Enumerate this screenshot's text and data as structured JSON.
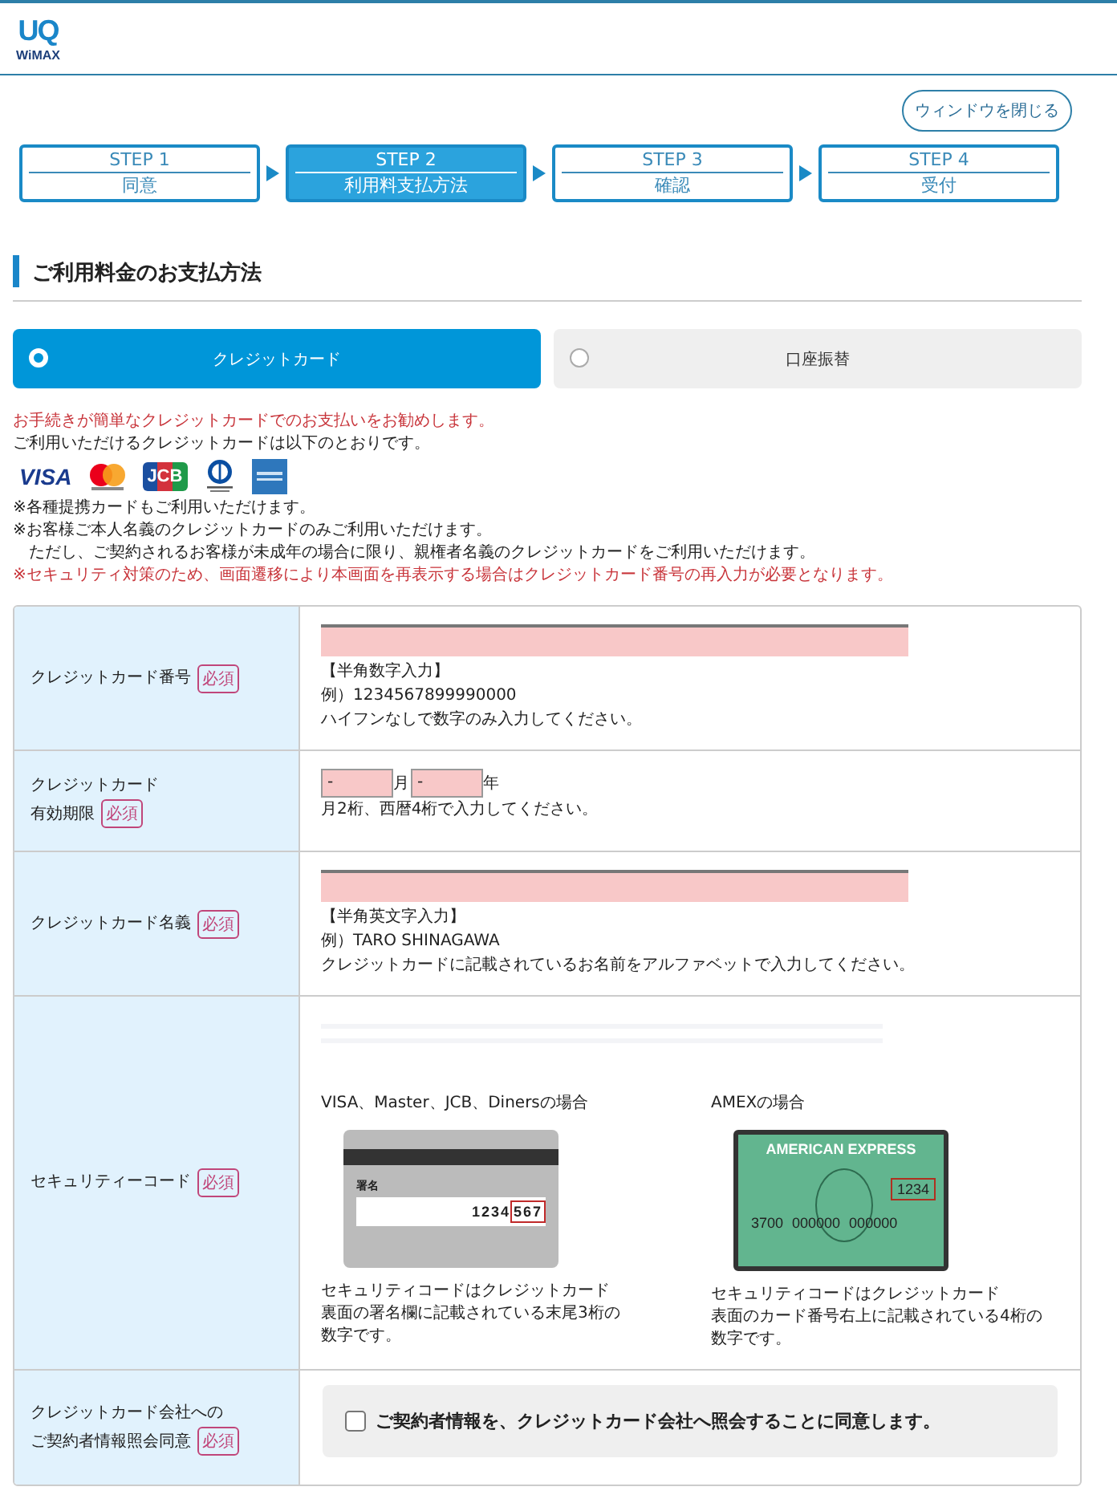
{
  "header": {
    "logo_top": "UQ",
    "logo_bottom": "WiMAX"
  },
  "close_button": "ウィンドウを閉じる",
  "steps": [
    {
      "step": "STEP 1",
      "label": "同意",
      "selected": false
    },
    {
      "step": "STEP 2",
      "label": "利用料支払方法",
      "selected": true
    },
    {
      "step": "STEP 3",
      "label": "確認",
      "selected": false
    },
    {
      "step": "STEP 4",
      "label": "受付",
      "selected": false
    }
  ],
  "section_title": "ご利用料金のお支払方法",
  "payment_tabs": [
    {
      "label": "クレジットカード",
      "selected": true
    },
    {
      "label": "口座振替",
      "selected": false
    }
  ],
  "notes_before": [
    {
      "kind": "alert",
      "text": "お手続きが簡単なクレジットカードでのお支払いをお勧めします。"
    },
    {
      "kind": "plain",
      "text": "ご利用いただけるクレジットカードは以下のとおりです。"
    }
  ],
  "card_brands": [
    {
      "kind": "visa",
      "label": "VISA"
    },
    {
      "kind": "mastercard"
    },
    {
      "kind": "jcb",
      "label": "JCB"
    },
    {
      "kind": "diners"
    },
    {
      "kind": "amex"
    }
  ],
  "notes_after": [
    {
      "kind": "plain",
      "text": "※各種提携カードもご利用いただけます。"
    },
    {
      "kind": "plain",
      "text": "※お客様ご本人名義のクレジットカードのみご利用いただけます。"
    },
    {
      "kind": "indent",
      "text": "ただし、ご契約されるお客様が未成年の場合に限り、親権者名義のクレジットカードをご利用いただけます。"
    },
    {
      "kind": "alert",
      "text": "※セキュリティ対策のため、画面遷移により本画面を再表示する場合はクレジットカード番号の再入力が必要となります。"
    }
  ],
  "form_rows": [
    {
      "kind": "text_input",
      "label": [
        "クレジットカード番号"
      ],
      "required": "必須",
      "hint": [
        "【半角数字入力】",
        "例）1234567899990000",
        "ハイフンなしで数字のみ入力してください。"
      ]
    },
    {
      "kind": "expiry",
      "label": [
        "クレジットカード",
        "有効期限"
      ],
      "required": "必須",
      "month": {
        "value": "-",
        "unit": "月"
      },
      "year": {
        "value": "-",
        "unit": "年"
      },
      "hint": [
        "月2桁、西暦4桁で入力してください。"
      ]
    },
    {
      "kind": "text_input",
      "label": [
        "クレジットカード名義"
      ],
      "required": "必須",
      "hint": [
        "【半角英文字入力】",
        "例）TARO SHINAGAWA",
        "クレジットカードに記載されているお名前をアルファベットで入力してください。"
      ]
    },
    {
      "kind": "security_code",
      "label": [
        "セキュリティーコード"
      ],
      "required": "必須",
      "cards": [
        {
          "kind": "back",
          "caption": "VISA、Master、JCB、Dinersの場合",
          "signature_label": "署名",
          "number": "1234",
          "code": "567",
          "description": [
            "セキュリティコードはクレジットカード",
            "裏面の署名欄に記載されている末尾3桁の",
            "数字です。"
          ]
        },
        {
          "kind": "amex",
          "caption": "AMEXの場合",
          "brand": "AMERICAN EXPRESS",
          "number": "3700 000000 000000",
          "code": "1234",
          "description": [
            "セキュリティコードはクレジットカード",
            "表面のカード番号右上に記載されている4桁の",
            "数字です。"
          ]
        }
      ]
    },
    {
      "kind": "consent",
      "label": [
        "クレジットカード会社への",
        "ご契約者情報照会同意"
      ],
      "required": "必須",
      "checkbox": {
        "label": "ご契約者情報を、クレジットカード会社へ照会することに同意します。",
        "checked": false
      }
    }
  ]
}
